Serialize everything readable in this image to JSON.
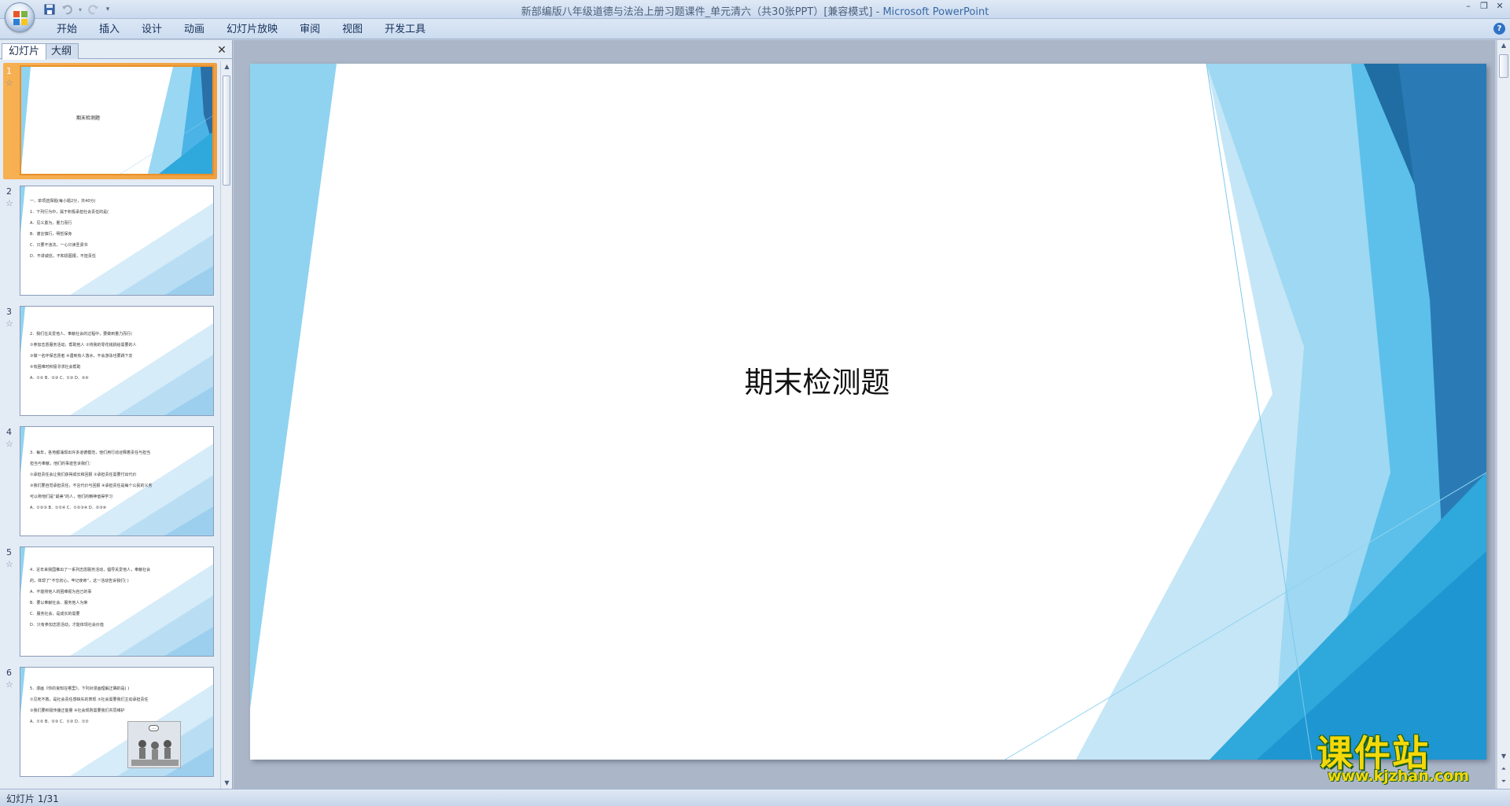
{
  "window": {
    "title": "新部编版八年级道德与法治上册习题课件_单元清六（共30张PPT）[兼容模式]",
    "app_name": "Microsoft PowerPoint",
    "separator": " - "
  },
  "quick_access": {
    "save_icon": "save-icon",
    "undo_icon": "undo-icon",
    "redo_icon": "redo-icon",
    "customize_icon": "customize-icon"
  },
  "ribbon": {
    "tabs": [
      "开始",
      "插入",
      "设计",
      "动画",
      "幻灯片放映",
      "审阅",
      "视图",
      "开发工具"
    ]
  },
  "left_pane": {
    "tab_slides": "幻灯片",
    "tab_outline": "大纲",
    "close_glyph": "✕"
  },
  "thumbnails": [
    {
      "num": "1",
      "title": "期末检测题",
      "lines": []
    },
    {
      "num": "2",
      "title": "",
      "lines": [
        "一、单项选择题(每小题2分，共40分)",
        "1．下列行为中，属于积极承担社会责任的是(",
        "A．见义勇为，量力而行",
        "B．谨言慎行，明哲保身",
        "C．只要不违法，一心只读圣贤书",
        "D．不讲诚信，不知恩图报，不担责任"
      ]
    },
    {
      "num": "3",
      "title": "",
      "lines": [
        "2．我们在关爱他人、奉献社会的过程中，要做到量力而行(",
        "①参加志愿服务活动，帮助他人  ②将我的零花钱捐给需要的人",
        "③做一名环保志愿者  ④遇到有人落水，不会游泳也要跳下去",
        "⑤有困难时积极寻求社会帮助",
        "A．①②  B．②③  C．①③  D．②④"
      ]
    },
    {
      "num": "4",
      "title": "",
      "lines": [
        "3．每年，各地都涌现出许多道德模范，他们用行动诠释着责任与担当",
        "担当与奉献，他们的事迹告诉我们：",
        "①承担责任会让我们获得成长和回报  ②承担责任需要付出代价",
        "③我们要自觉承担责任，不言代价与回报  ④承担责任是每个公民的义务",
        "可以称他们是“最美”的人，他们的精神值得学习",
        "A．①②③  B．①②④  C．①②③④  D．②③④"
      ]
    },
    {
      "num": "5",
      "title": "",
      "lines": [
        "4．近年来我国推出了一系列志愿服务活动，倡导关爱他人，奉献社会",
        "的，体现了“不忘初心，牢记使命”，这一活动告诉我们(  )",
        "A．不能将他人的困难视为自己的事",
        "B．要以奉献社会、服务他人为荣",
        "C．服务社会，是成长的需要",
        "D．只有参加志愿活动，才能体现社会价值"
      ]
    },
    {
      "num": "6",
      "title": "",
      "lines": [
        "5．漫画《你的良知在哪里》，下列对漫画理解正确的是(      )",
        "①见死不救，是社会责任感缺失的表现  ②社会需要我们主动承担责任",
        "③我们要积极传播正能量  ④社会规则需要我们共同维护",
        "A．①②  B．②③  C．①③  D．①②"
      ]
    }
  ],
  "slide": {
    "title": "期末检测题"
  },
  "status": {
    "slide_indicator": "幻灯片 1/31"
  },
  "watermark": {
    "text_cn": "课件站",
    "url": "www.kjzhan.com"
  },
  "colors": {
    "accent_light": "#8fd3f0",
    "accent_mid": "#4bb3e6",
    "accent_dark": "#1f6da3",
    "accent_deep": "#2a7bb5",
    "selected_thumb": "#f0a040"
  }
}
